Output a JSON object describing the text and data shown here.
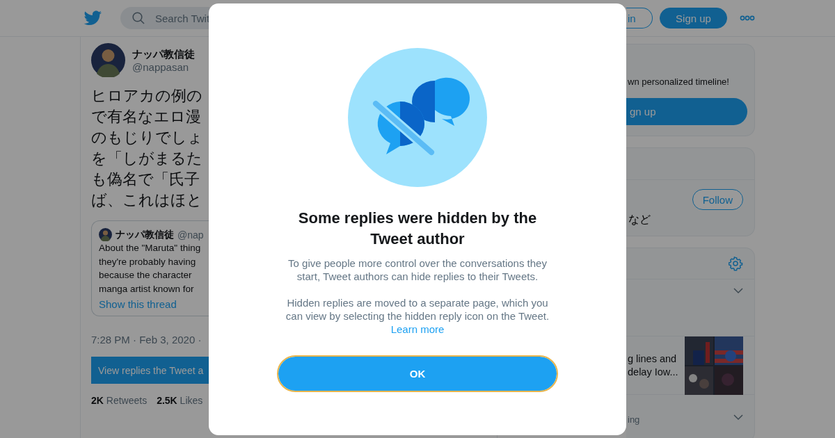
{
  "header": {
    "search": {
      "placeholder": "Search Twit"
    },
    "buttons": [
      {
        "label": "in",
        "kind": "outline"
      },
      {
        "label": "Sign up",
        "kind": "filled"
      }
    ]
  },
  "tweet": {
    "name": "ナッパ教信徒",
    "handle": "@nappasan",
    "lines": [
      "ヒロアカの例の",
      "で有名なエロ漫",
      "のもじりでしょ",
      "を「しがまるた",
      "も偽名で「氏子",
      "ば、これはほと"
    ],
    "quote": {
      "name": "ナッパ教信徒",
      "handle": "@nap",
      "lines": [
        "About the \"Maruta\" thing",
        "they're probably having",
        "because the character",
        "manga artist known for"
      ],
      "link": "Show this thread"
    },
    "timestamp": "7:28 PM · Feb 3, 2020 ·",
    "view_replies": "View replies the Tweet a",
    "stats": [
      {
        "count": "2K",
        "label": "Retweets"
      },
      {
        "count": "2.5K",
        "label": "Likes"
      }
    ]
  },
  "sidebar": {
    "signup_card": {
      "text": "wn personalized timeline!",
      "button": "gn up"
    },
    "follow_card": {
      "button": "Follow",
      "text": "など"
    },
    "trends": [
      {
        "kind": "topic"
      },
      {
        "kind": "news",
        "lines": [
          "g lines and",
          "delay Iow..."
        ]
      },
      {
        "kind": "trend",
        "context": "ing"
      }
    ]
  },
  "modal": {
    "title": "Some replies were hidden by the Tweet author",
    "paragraphs": [
      "To give people more control over the conversations they start, Tweet authors can hide replies to their Tweets.",
      "Hidden replies are moved to a separate page, which you can view by selecting the hidden reply icon on the Tweet."
    ],
    "link": "Learn more",
    "button": "OK"
  }
}
